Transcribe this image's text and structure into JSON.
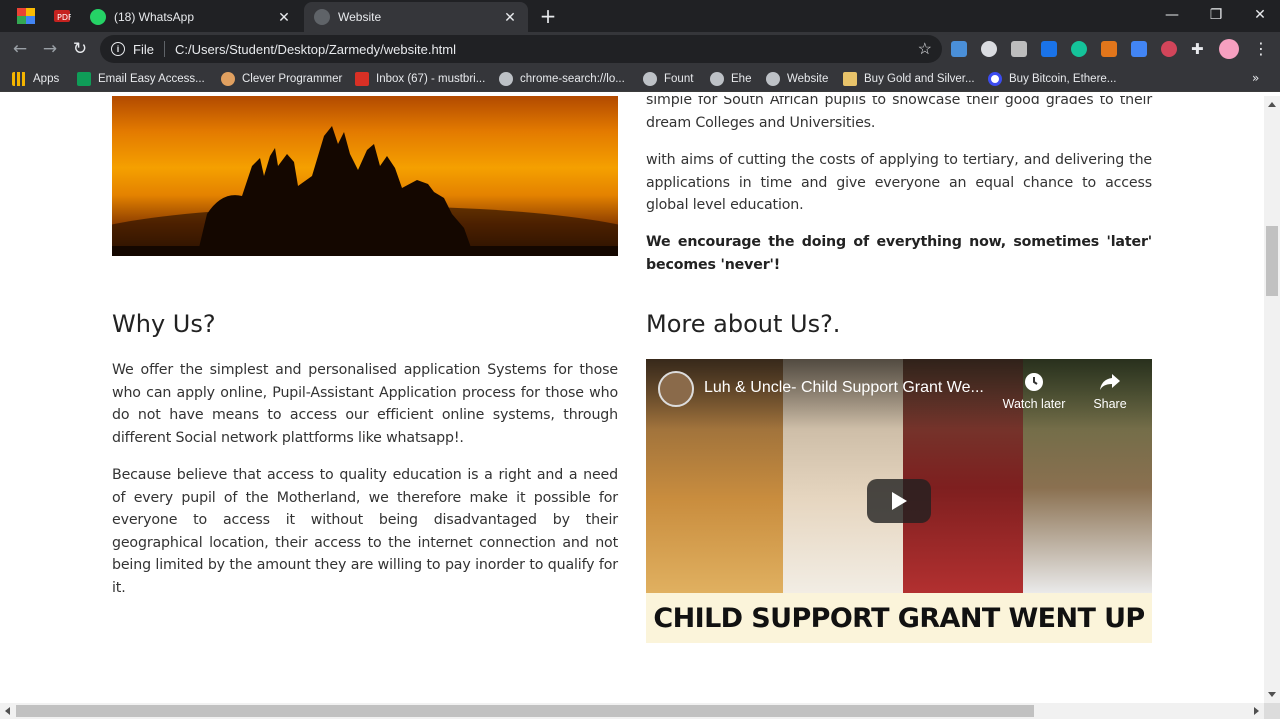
{
  "browser": {
    "tabs": [
      {
        "title": "(18) WhatsApp"
      },
      {
        "title": "Website"
      }
    ],
    "new_tab": "+",
    "address": {
      "scheme": "File",
      "url": "C:/Users/Student/Desktop/Zarmedy/website.html"
    },
    "bookmarks": [
      {
        "label": "Apps",
        "icon": "apps-grid-icon",
        "color": "#f4b400"
      },
      {
        "label": "Email Easy Access...",
        "icon": "sheets-icon",
        "color": "#0f9d58"
      },
      {
        "label": "Clever Programmer",
        "icon": "clever-programmer-icon",
        "color": "#e0a060"
      },
      {
        "label": "Inbox (67) - mustbri...",
        "icon": "gmail-icon",
        "color": "#d93025"
      },
      {
        "label": "chrome-search://lo...",
        "icon": "globe-icon",
        "color": "#bdc1c6"
      },
      {
        "label": "Fount",
        "icon": "globe-icon",
        "color": "#bdc1c6"
      },
      {
        "label": "Ehe",
        "icon": "globe-icon",
        "color": "#bdc1c6"
      },
      {
        "label": "Website",
        "icon": "globe-icon",
        "color": "#bdc1c6"
      },
      {
        "label": "Buy Gold and Silver...",
        "icon": "folder-icon",
        "color": "#e8c36a"
      },
      {
        "label": "Buy Bitcoin, Ethere...",
        "icon": "circle-o-icon",
        "color": "#3c4cf0"
      }
    ],
    "more_bookmarks": "»"
  },
  "page": {
    "intro_tail": "simple for South African pupils to showcase their good grades to their dream Colleges and Universities.",
    "intro_p2": "with aims of cutting the costs of applying to tertiary, and delivering the applications in time and give everyone an equal chance to access global level education.",
    "intro_bold": "We encourage the doing of everything now, sometimes 'later' becomes 'never'!",
    "why": {
      "heading": "Why Us?",
      "p1": "We offer the simplest and personalised application Systems for those who can apply online, Pupil-Assistant Application process for those who do not have means to access our efficient online systems, through different Social network plattforms like whatsapp!.",
      "p2": "Because believe that access to quality education is a right and a need of every pupil of the Motherland, we therefore make it possible for everyone to access it without being disadvantaged by their geographical location, their access to the internet connection and not being limited by the amount they are willing to pay inorder to qualify for it."
    },
    "more": {
      "heading": "More about Us?.",
      "video": {
        "title": "Luh & Uncle- Child Support Grant We...",
        "watch_later": "Watch later",
        "share": "Share",
        "caption": "CHILD SUPPORT GRANT WENT UP"
      }
    }
  }
}
